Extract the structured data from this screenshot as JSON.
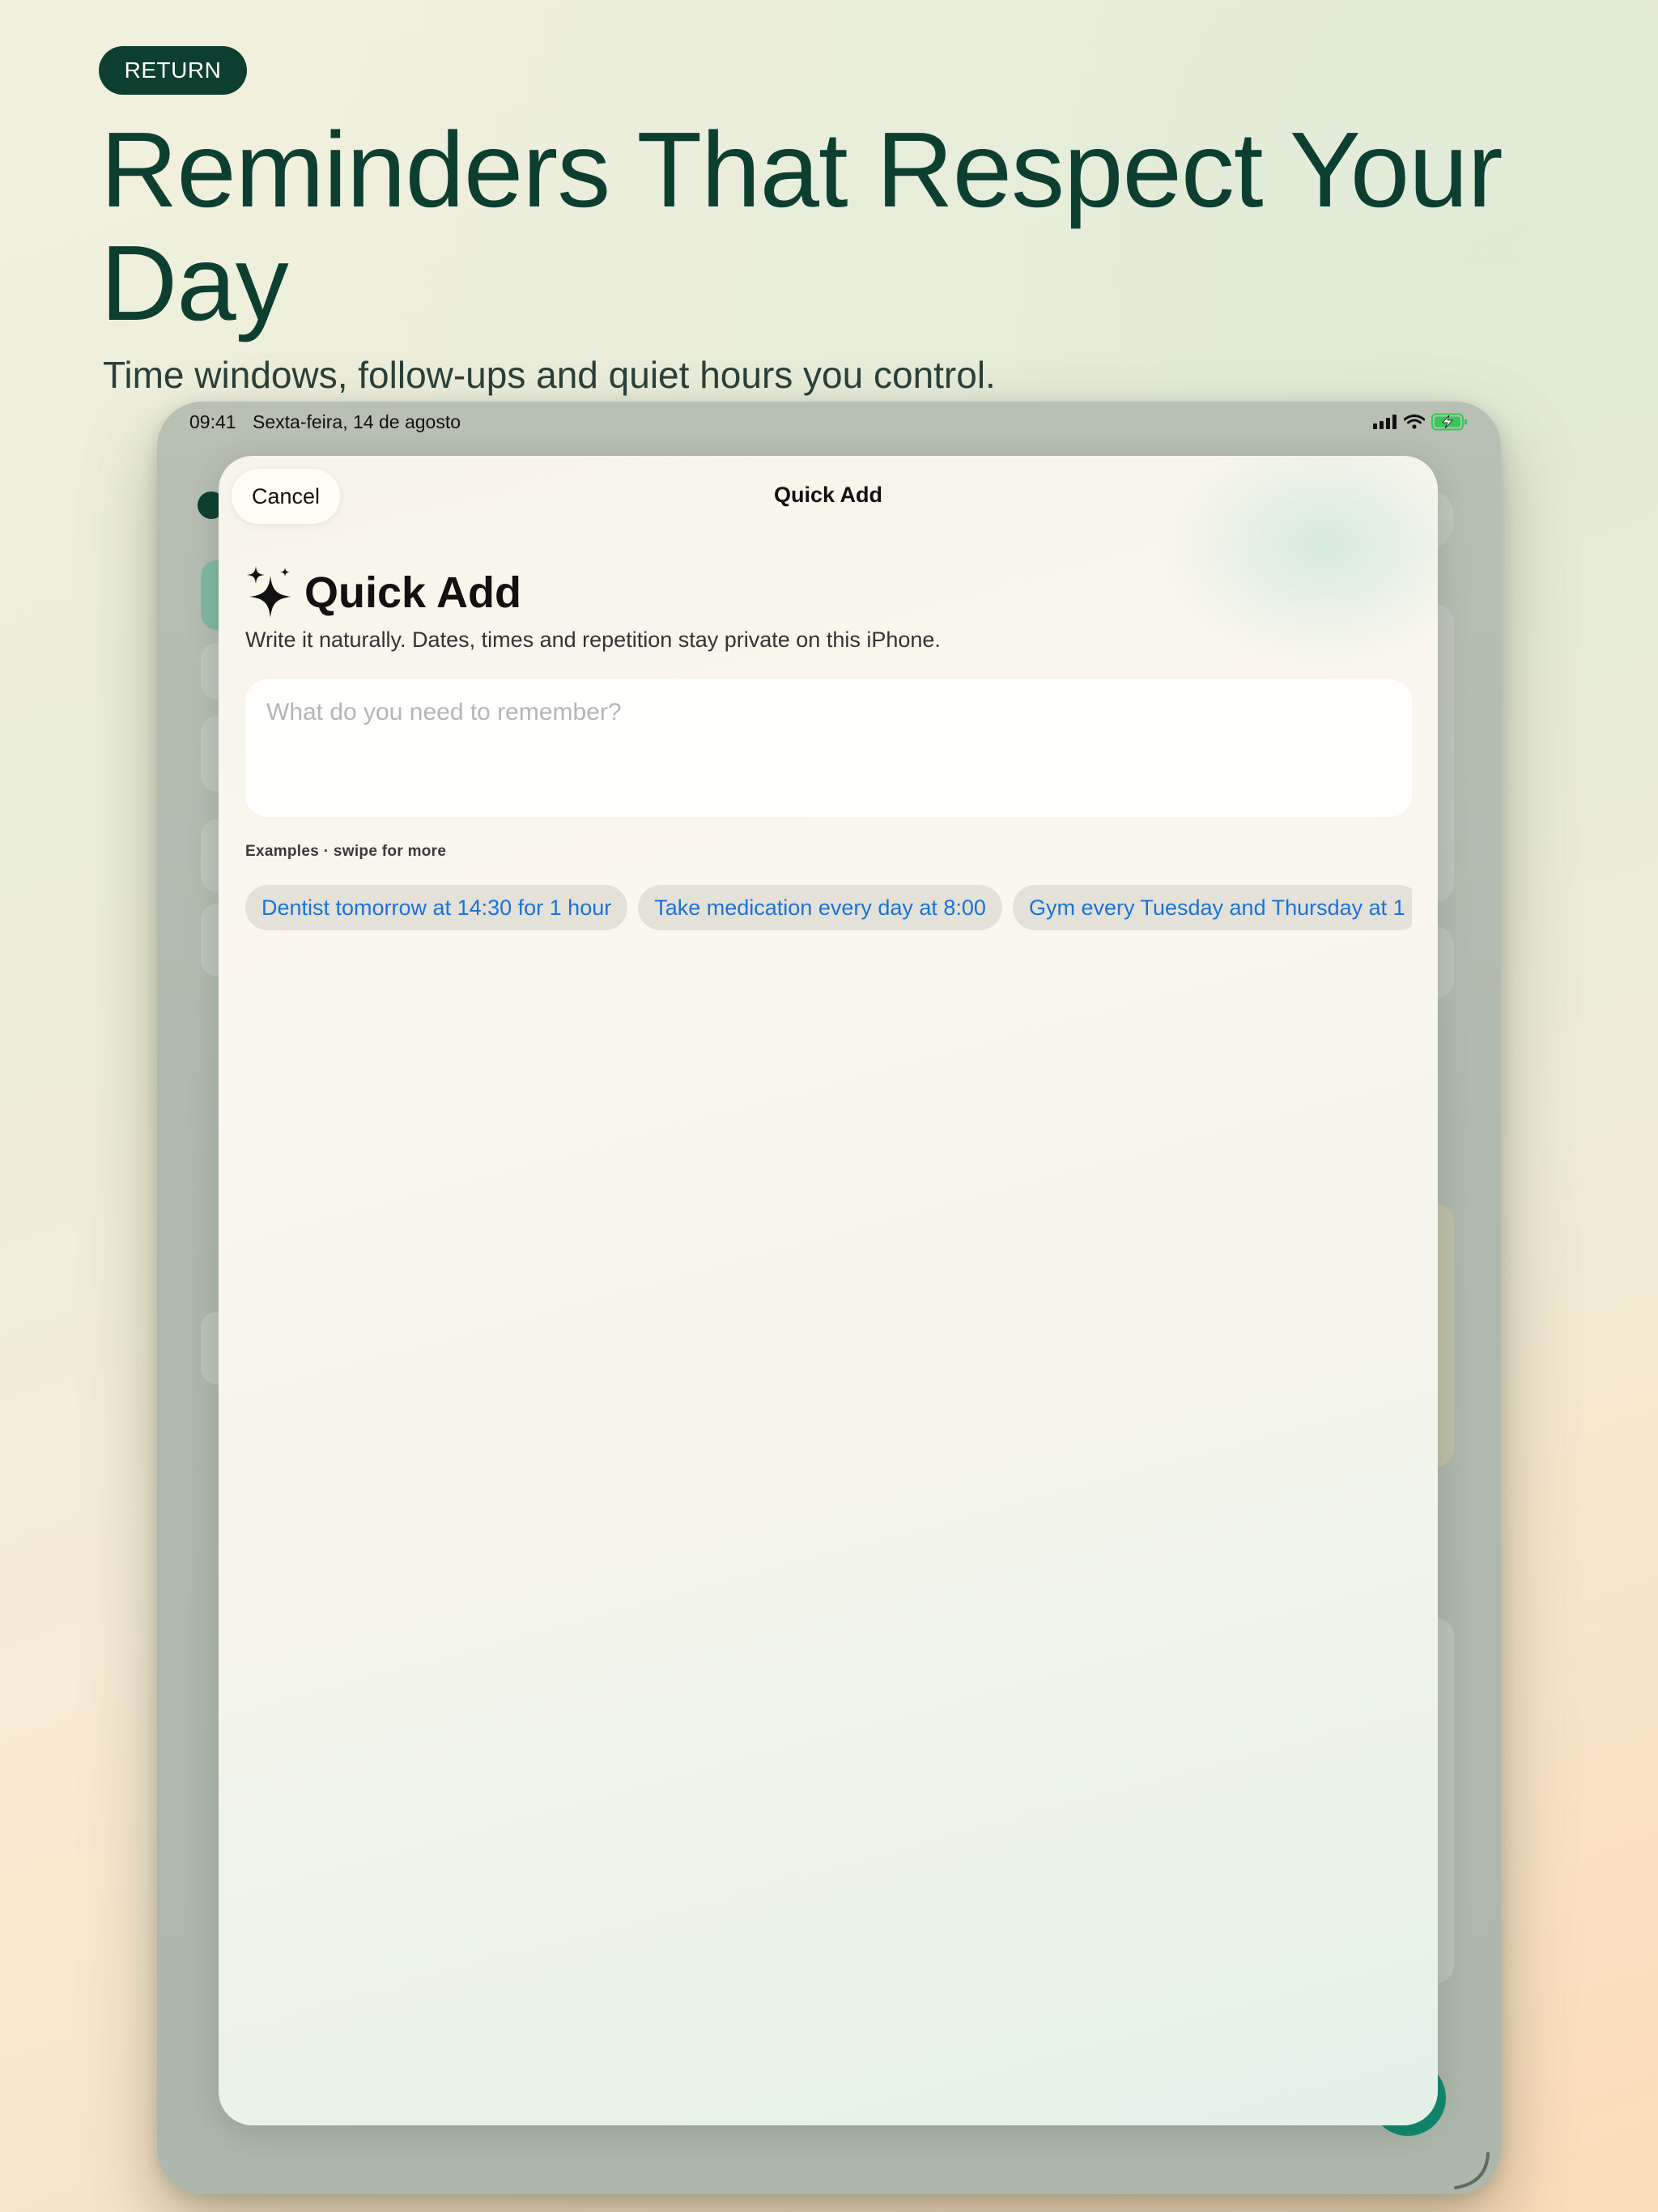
{
  "header": {
    "return_label": "RETURN",
    "title": "Reminders That Respect Your Day",
    "subtitle": "Time windows, follow-ups and quiet hours you control."
  },
  "status_bar": {
    "time": "09:41",
    "date": "Sexta-feira, 14 de agosto",
    "icons": [
      "signal-icon",
      "wifi-icon",
      "battery-charging-icon"
    ]
  },
  "sheet": {
    "cancel_label": "Cancel",
    "nav_title": "Quick Add",
    "heading": "Quick Add",
    "heading_icon": "sparkles-icon",
    "description": "Write it naturally. Dates, times and repetition stay private on this iPhone.",
    "input": {
      "value": "",
      "placeholder": "What do you need to remember?"
    },
    "examples_label": "Examples · swipe for more",
    "examples": [
      "Dentist tomorrow at 14:30 for 1 hour",
      "Take medication every day at 8:00",
      "Gym every Tuesday and Thursday at 1"
    ]
  },
  "colors": {
    "brand_dark_green": "#0d3f30",
    "link_blue": "#1a73d9",
    "accent_teal": "#0f8a70",
    "battery_green": "#34c759"
  }
}
